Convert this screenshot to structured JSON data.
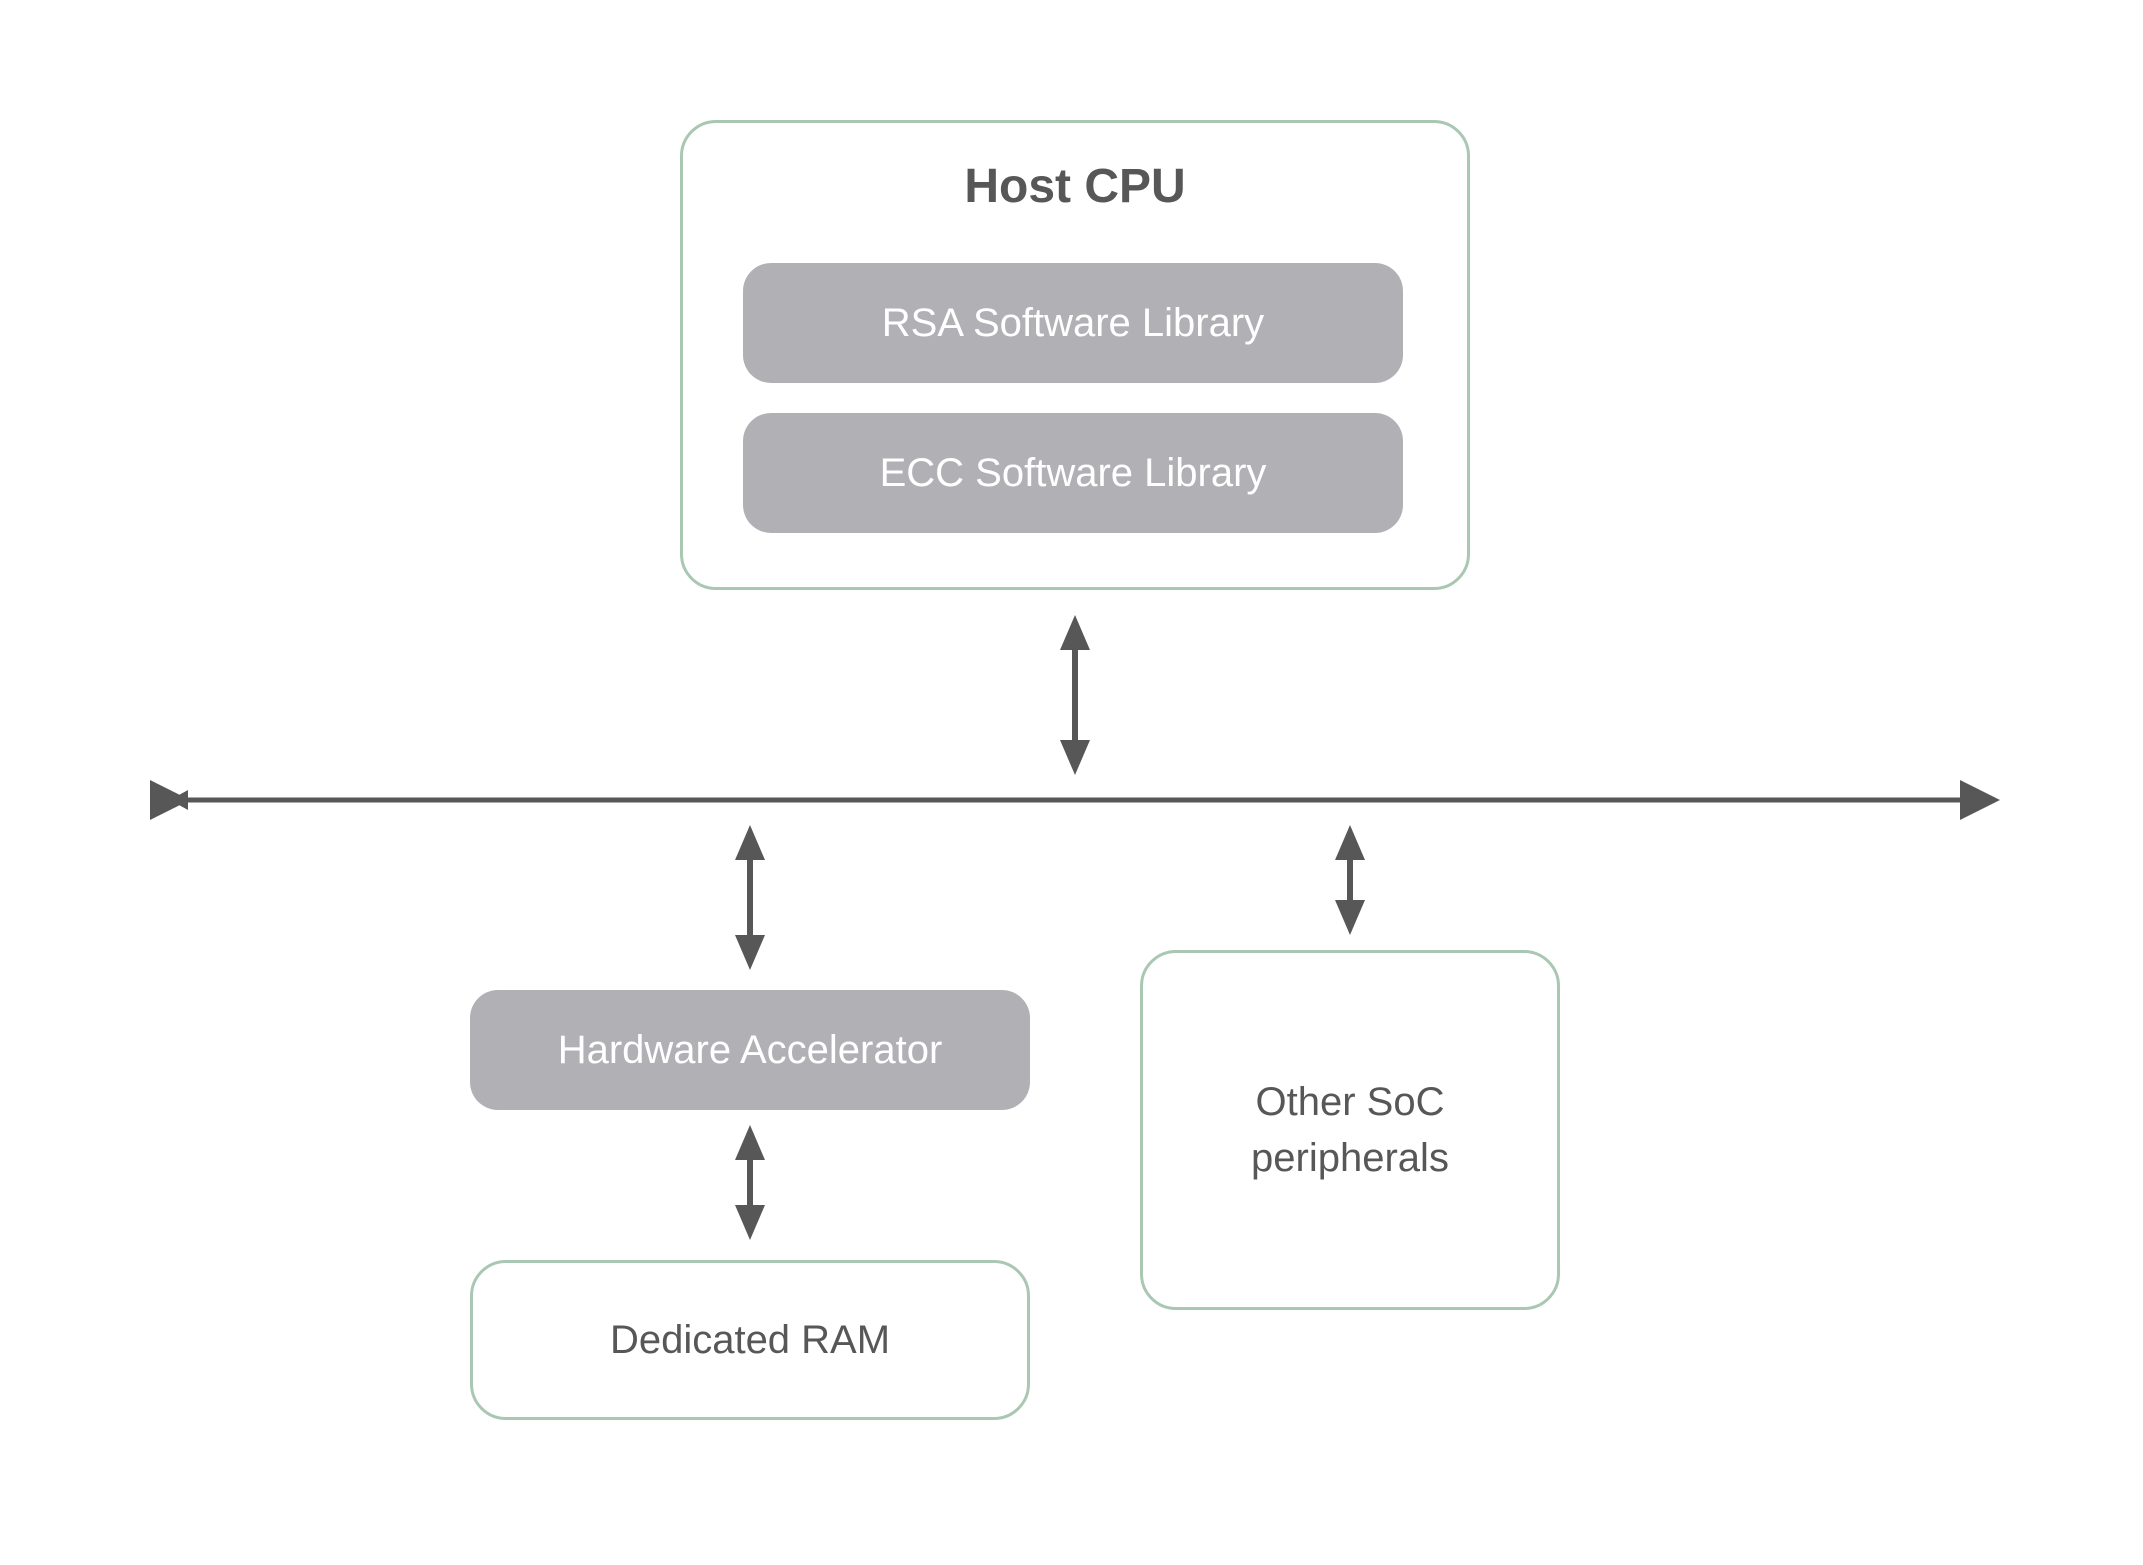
{
  "hostCpu": {
    "title": "Host CPU",
    "lib1": "RSA Software Library",
    "lib2": "ECC Software Library"
  },
  "hwAccel": "Hardware Accelerator",
  "ram": "Dedicated RAM",
  "other": "Other SoC peripherals",
  "colors": {
    "outline": "#aac7b3",
    "filled": "#b1b0b4",
    "textDark": "#575757",
    "textLight": "#ffffff",
    "arrow": "#575757"
  }
}
